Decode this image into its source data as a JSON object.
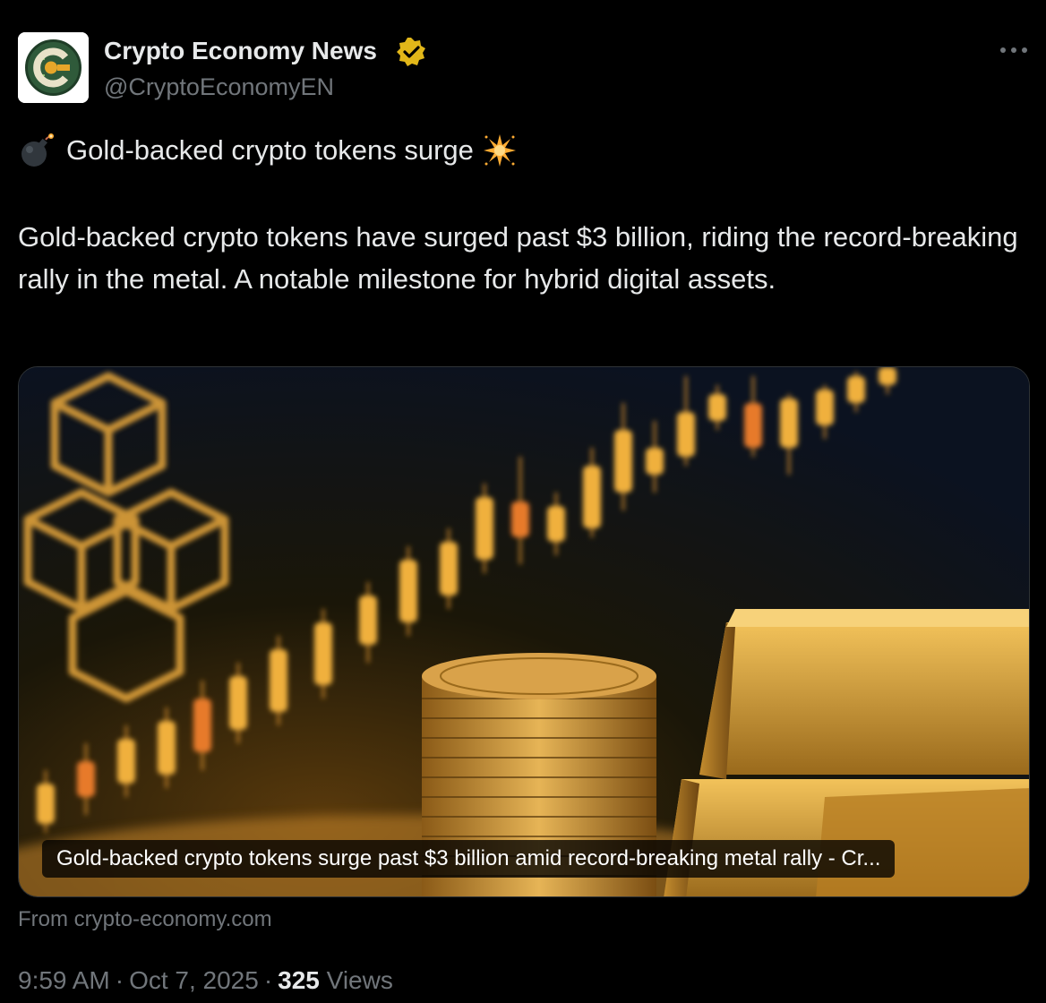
{
  "author": {
    "name": "Crypto Economy News",
    "handle": "@CryptoEconomyEN",
    "verified_badge_color": "#e2b719",
    "avatar_icon": "crypto-economy-logo"
  },
  "post": {
    "headline_emoji_left": "bomb-emoji",
    "headline": "Gold-backed crypto tokens surge",
    "headline_emoji_right": "sparkle-burst-emoji",
    "body": "Gold-backed crypto tokens have surged past $3 billion, riding the record-breaking rally in the metal. A notable milestone for hybrid digital assets."
  },
  "link_card": {
    "image_description_icon": "gold-bars-coins-candlestick-chart-image",
    "caption": "Gold-backed crypto tokens surge past $3 billion amid record-breaking metal rally - Cr...",
    "source": "From crypto-economy.com"
  },
  "meta": {
    "time": "9:59 AM",
    "date": "Oct 7, 2025",
    "views_count": "325",
    "views_label": "Views"
  },
  "colors": {
    "background": "#000000",
    "primary_text": "#e7e9ea",
    "secondary_text": "#71767b",
    "border": "#2f3336"
  }
}
